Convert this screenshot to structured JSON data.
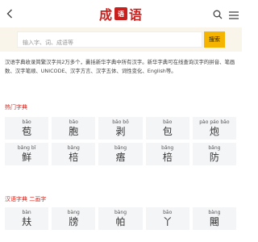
{
  "header": {
    "logo_char1": "成",
    "logo_seal": "语",
    "logo_char3": "语"
  },
  "search": {
    "placeholder": "输入字、词、成语等",
    "button_label": "搜索"
  },
  "intro_text": "汉语字典收录简繁汉字共2万多个，囊括新华字典中所有汉字。新华字典可在线查询汉字的拼音、笔画数、汉字笔顺、UNICODE、汉字方言、汉字五体、词性变化、English等。",
  "hot": {
    "title": "热门字典",
    "items": [
      {
        "pinyin": "bāo",
        "char": "苞"
      },
      {
        "pinyin": "bāo",
        "char": "胞"
      },
      {
        "pinyin": "bāo bō",
        "char": "剥"
      },
      {
        "pinyin": "bāo",
        "char": "包"
      },
      {
        "pinyin": "pào páo bāo",
        "char": "炮"
      },
      {
        "pinyin": "bǎng bǐ",
        "char": "鲜"
      },
      {
        "pinyin": "bǎng",
        "char": "棓"
      },
      {
        "pinyin": "bǎng",
        "char": "痦"
      },
      {
        "pinyin": "bǎng",
        "char": "棓"
      },
      {
        "pinyin": "bǎng",
        "char": "防"
      }
    ]
  },
  "two_char": {
    "title": "汉语字典 二画字",
    "items": [
      {
        "pinyin": "bàn",
        "char": "㚘"
      },
      {
        "pinyin": "bàng",
        "char": "牓"
      },
      {
        "pinyin": "bàng",
        "char": "帕"
      },
      {
        "pinyin": "bāo",
        "char": "丫"
      },
      {
        "pinyin": "bàng",
        "char": "闀"
      }
    ]
  }
}
